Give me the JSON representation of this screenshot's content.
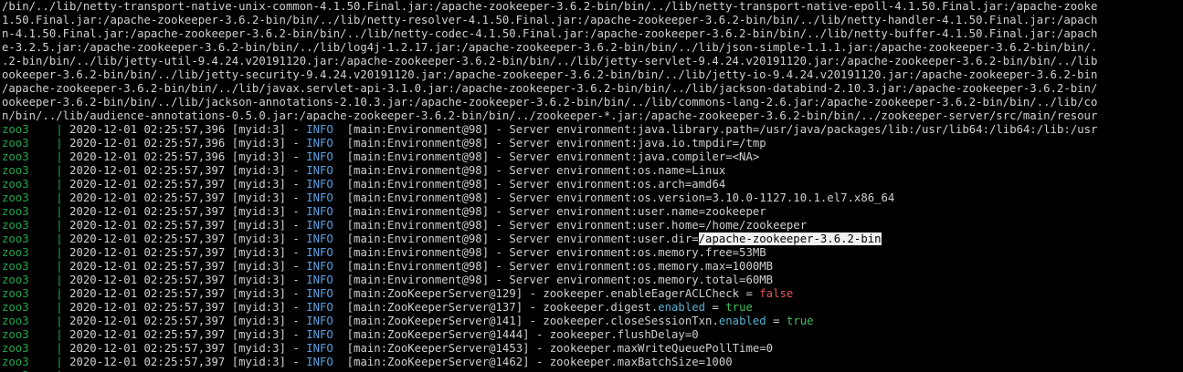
{
  "classpath_lines": [
    "/bin/../lib/netty-transport-native-unix-common-4.1.50.Final.jar:/apache-zookeeper-3.6.2-bin/bin/../lib/netty-transport-native-epoll-4.1.50.Final.jar:/apache-zooke",
    "1.50.Final.jar:/apache-zookeeper-3.6.2-bin/bin/../lib/netty-resolver-4.1.50.Final.jar:/apache-zookeeper-3.6.2-bin/bin/../lib/netty-handler-4.1.50.Final.jar:/apach",
    "n-4.1.50.Final.jar:/apache-zookeeper-3.6.2-bin/bin/../lib/netty-codec-4.1.50.Final.jar:/apache-zookeeper-3.6.2-bin/bin/../lib/netty-buffer-4.1.50.Final.jar:/apach",
    "e-3.2.5.jar:/apache-zookeeper-3.6.2-bin/bin/../lib/log4j-1.2.17.jar:/apache-zookeeper-3.6.2-bin/bin/../lib/json-simple-1.1.1.jar:/apache-zookeeper-3.6.2-bin/bin/.",
    ".2-bin/bin/../lib/jetty-util-9.4.24.v20191120.jar:/apache-zookeeper-3.6.2-bin/bin/../lib/jetty-servlet-9.4.24.v20191120.jar:/apache-zookeeper-3.6.2-bin/bin/../lib",
    "ookeeper-3.6.2-bin/bin/../lib/jetty-security-9.4.24.v20191120.jar:/apache-zookeeper-3.6.2-bin/bin/../lib/jetty-io-9.4.24.v20191120.jar:/apache-zookeeper-3.6.2-bin",
    "/apache-zookeeper-3.6.2-bin/bin/../lib/javax.servlet-api-3.1.0.jar:/apache-zookeeper-3.6.2-bin/bin/../lib/jackson-databind-2.10.3.jar:/apache-zookeeper-3.6.2-bin/",
    "ookeeper-3.6.2-bin/bin/../lib/jackson-annotations-2.10.3.jar:/apache-zookeeper-3.6.2-bin/bin/../lib/commons-lang-2.6.jar:/apache-zookeeper-3.6.2-bin/bin/../lib/co",
    "n/bin/../lib/audience-annotations-0.5.0.jar:/apache-zookeeper-3.6.2-bin/bin/../zookeeper-*.jar:/apache-zookeeper-3.6.2-bin/bin/../zookeeper-server/src/main/resour"
  ],
  "log": {
    "container": "zoo3",
    "separator": "|",
    "level": "INFO",
    "dash": "-",
    "entries": [
      {
        "ts": "2020-12-01 02:25:57,396",
        "thread": "[myid:3]",
        "source": "[main:Environment@98]",
        "msg": "Server environment:java.library.path=/usr/java/packages/lib:/usr/lib64:/lib64:/lib:/usr"
      },
      {
        "ts": "2020-12-01 02:25:57,396",
        "thread": "[myid:3]",
        "source": "[main:Environment@98]",
        "msg": "Server environment:java.io.tmpdir=/tmp"
      },
      {
        "ts": "2020-12-01 02:25:57,396",
        "thread": "[myid:3]",
        "source": "[main:Environment@98]",
        "msg": "Server environment:java.compiler=<NA>"
      },
      {
        "ts": "2020-12-01 02:25:57,397",
        "thread": "[myid:3]",
        "source": "[main:Environment@98]",
        "msg": "Server environment:os.name=Linux"
      },
      {
        "ts": "2020-12-01 02:25:57,397",
        "thread": "[myid:3]",
        "source": "[main:Environment@98]",
        "msg": "Server environment:os.arch=amd64"
      },
      {
        "ts": "2020-12-01 02:25:57,397",
        "thread": "[myid:3]",
        "source": "[main:Environment@98]",
        "msg": "Server environment:os.version=3.10.0-1127.10.1.el7.x86_64"
      },
      {
        "ts": "2020-12-01 02:25:57,397",
        "thread": "[myid:3]",
        "source": "[main:Environment@98]",
        "msg": "Server environment:user.name=zookeeper"
      },
      {
        "ts": "2020-12-01 02:25:57,397",
        "thread": "[myid:3]",
        "source": "[main:Environment@98]",
        "msg": "Server environment:user.home=/home/zookeeper"
      },
      {
        "ts": "2020-12-01 02:25:57,397",
        "thread": "[myid:3]",
        "source": "[main:Environment@98]",
        "msg": "Server environment:user.dir=",
        "selected": "/apache-zookeeper-3.6.2-bin"
      },
      {
        "ts": "2020-12-01 02:25:57,397",
        "thread": "[myid:3]",
        "source": "[main:Environment@98]",
        "msg": "Server environment:os.memory.free=53MB"
      },
      {
        "ts": "2020-12-01 02:25:57,397",
        "thread": "[myid:3]",
        "source": "[main:Environment@98]",
        "msg": "Server environment:os.memory.max=1000MB"
      },
      {
        "ts": "2020-12-01 02:25:57,397",
        "thread": "[myid:3]",
        "source": "[main:Environment@98]",
        "msg": "Server environment:os.memory.total=60MB"
      },
      {
        "ts": "2020-12-01 02:25:57,397",
        "thread": "[myid:3]",
        "source": "[main:ZooKeeperServer@129]",
        "msg": "zookeeper.enableEagerACLCheck = ",
        "value": "false",
        "value_class": "c-false"
      },
      {
        "ts": "2020-12-01 02:25:57,397",
        "thread": "[myid:3]",
        "source": "[main:ZooKeeperServer@137]",
        "msg": "zookeeper.digest.",
        "kw": "enabled",
        "mid": " = ",
        "value": "true",
        "value_class": "c-true"
      },
      {
        "ts": "2020-12-01 02:25:57,397",
        "thread": "[myid:3]",
        "source": "[main:ZooKeeperServer@141]",
        "msg": "zookeeper.closeSessionTxn.",
        "kw": "enabled",
        "mid": " = ",
        "value": "true",
        "value_class": "c-true"
      },
      {
        "ts": "2020-12-01 02:25:57,397",
        "thread": "[myid:3]",
        "source": "[main:ZooKeeperServer@1444]",
        "msg": "zookeeper.flushDelay=0"
      },
      {
        "ts": "2020-12-01 02:25:57,397",
        "thread": "[myid:3]",
        "source": "[main:ZooKeeperServer@1453]",
        "msg": "zookeeper.maxWriteQueuePollTime=0"
      },
      {
        "ts": "2020-12-01 02:25:57,397",
        "thread": "[myid:3]",
        "source": "[main:ZooKeeperServer@1462]",
        "msg": "zookeeper.maxBatchSize=1000"
      }
    ]
  },
  "colors": {
    "background": "#000000",
    "container": "#22a84a",
    "level_info": "#5aa0e0",
    "value_true": "#3ec15a",
    "value_false": "#e05555",
    "keyword_enabled": "#5ab0d0",
    "selection": "#f0f0f0"
  }
}
